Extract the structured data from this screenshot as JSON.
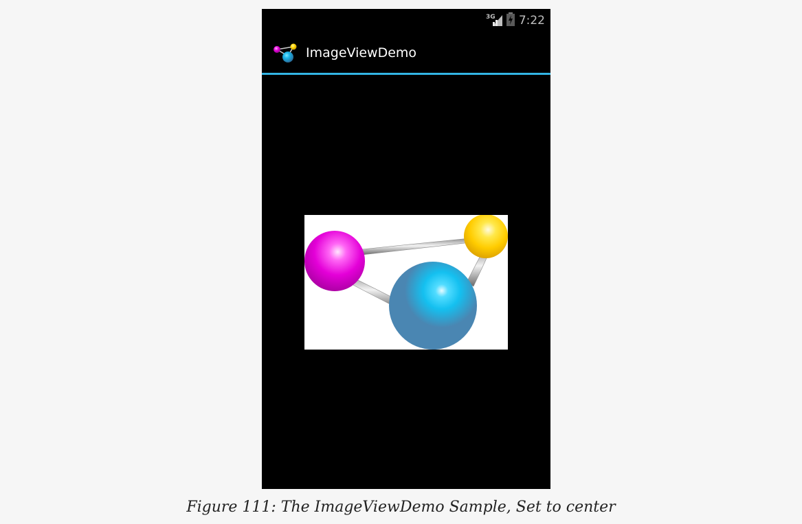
{
  "status_bar": {
    "network_label": "3G",
    "time": "7:22"
  },
  "action_bar": {
    "title": "ImageViewDemo",
    "accent_color": "#33b5e5"
  },
  "image_view": {
    "scale_type": "center",
    "background": "#ffffff",
    "molecule_colors": {
      "magenta": "#e400d8",
      "yellow": "#ffd400",
      "blue": "#4a86b2",
      "cyan_highlight": "#14c8f5"
    }
  },
  "caption": "Figure 111: The ImageViewDemo Sample, Set to center"
}
